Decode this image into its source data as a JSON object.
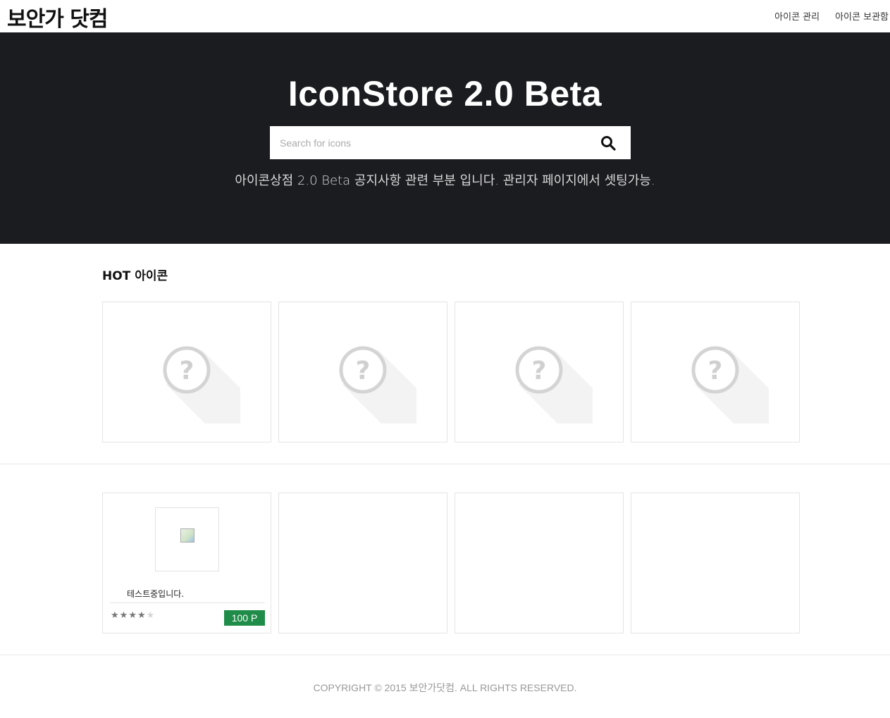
{
  "header": {
    "logo": "보안가 닷컴",
    "nav": [
      {
        "label": "아이콘 관리"
      },
      {
        "label": "아이콘 보관함"
      }
    ]
  },
  "hero": {
    "title": "IconStore 2.0 Beta",
    "search_placeholder": "Search for icons",
    "search_icon": "search-icon",
    "notice": "아이콘상점 2.0 Beta 공지사항 관련 부분 입니다. 관리자 페이지에서 셋팅가능."
  },
  "hot": {
    "title": "HOT 아이콘",
    "cards": [
      {
        "icon": "question-icon"
      },
      {
        "icon": "question-icon"
      },
      {
        "icon": "question-icon"
      },
      {
        "icon": "question-icon"
      }
    ]
  },
  "items": [
    {
      "title": "테스트중입니다.",
      "rating": 4,
      "rating_max": 5,
      "price": "100 P"
    }
  ],
  "footer": {
    "copyright": "COPYRIGHT © 2015 보안가닷컴. ALL RIGHTS RESERVED."
  },
  "colors": {
    "hero_bg": "#1b1c20",
    "price_bg": "#1f8c49"
  }
}
